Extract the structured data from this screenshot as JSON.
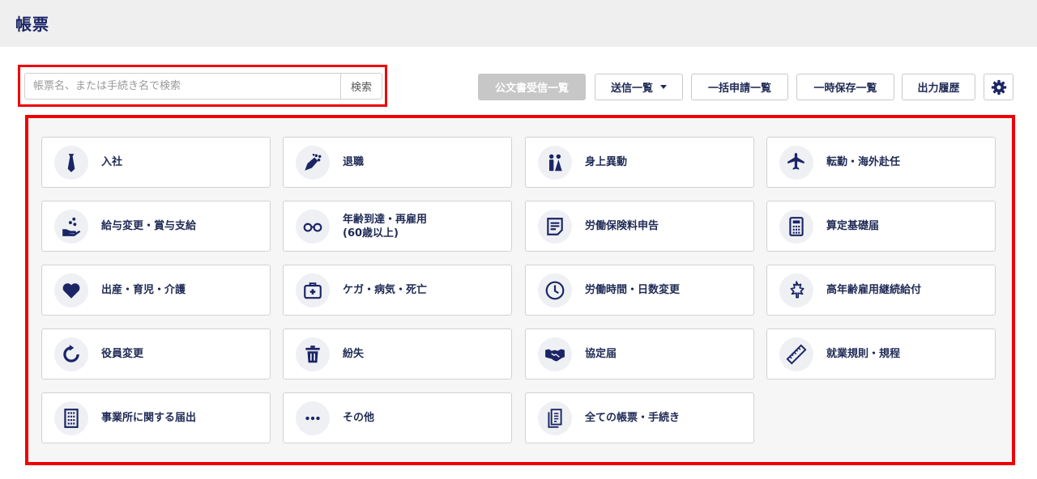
{
  "header": {
    "title": "帳票"
  },
  "search": {
    "placeholder": "帳票名、または手続き名で検索",
    "button_label": "検索"
  },
  "toolbar": {
    "public_docs_label": "公文書受信一覧",
    "send_list_label": "送信一覧",
    "bulk_apply_label": "一括申請一覧",
    "temp_save_label": "一時保存一覧",
    "output_history_label": "出力履歴",
    "settings_icon": "gear-icon"
  },
  "accent_color": "#1b2566",
  "highlight_color": "#ee0000",
  "tiles": [
    {
      "label": "入社",
      "icon": "necktie-icon"
    },
    {
      "label": "退職",
      "icon": "bouquet-icon"
    },
    {
      "label": "身上異動",
      "icon": "wedding-couple-icon"
    },
    {
      "label": "転勤・海外赴任",
      "icon": "airplane-icon"
    },
    {
      "label": "給与変更・賞与支給",
      "icon": "hand-coins-icon"
    },
    {
      "label": "年齢到達・再雇用\n(60歳以上)",
      "icon": "glasses-icon"
    },
    {
      "label": "労働保険料申告",
      "icon": "document-lines-icon"
    },
    {
      "label": "算定基礎届",
      "icon": "calculator-icon"
    },
    {
      "label": "出産・育児・介護",
      "icon": "heart-icon"
    },
    {
      "label": "ケガ・病気・死亡",
      "icon": "first-aid-kit-icon"
    },
    {
      "label": "労働時間・日数変更",
      "icon": "clock-icon"
    },
    {
      "label": "高年齢雇用継続給付",
      "icon": "maple-leaf-icon"
    },
    {
      "label": "役員変更",
      "icon": "refresh-icon"
    },
    {
      "label": "紛失",
      "icon": "trash-icon"
    },
    {
      "label": "協定届",
      "icon": "handshake-icon"
    },
    {
      "label": "就業規則・規程",
      "icon": "ruler-icon"
    },
    {
      "label": "事業所に関する届出",
      "icon": "building-icon"
    },
    {
      "label": "その他",
      "icon": "more-dots-icon"
    },
    {
      "label": "全ての帳票・手続き",
      "icon": "documents-icon"
    }
  ]
}
